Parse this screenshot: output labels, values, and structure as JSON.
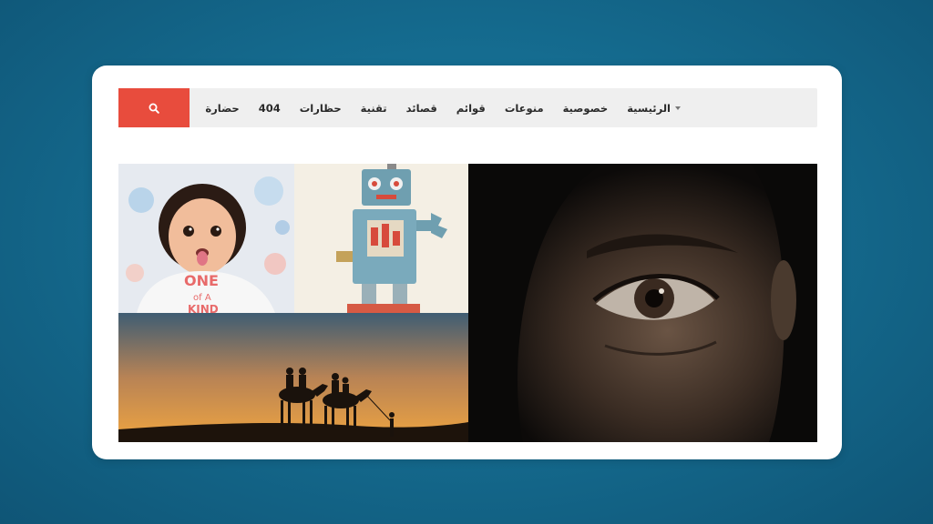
{
  "colors": {
    "background": "#156c90",
    "card": "#ffffff",
    "navbar": "#efefef",
    "search_button": "#e84c3d",
    "menu_text": "#2a2a2a"
  },
  "search": {
    "icon": "search-icon"
  },
  "menu": {
    "items": [
      {
        "label": "الرئيسية",
        "has_dropdown": true
      },
      {
        "label": "خصوصية"
      },
      {
        "label": "منوعات"
      },
      {
        "label": "قوائم"
      },
      {
        "label": "قصائد"
      },
      {
        "label": "تقنية"
      },
      {
        "label": "حظارات"
      },
      {
        "label": "404"
      },
      {
        "label": "حضارة"
      }
    ]
  },
  "gallery": {
    "tiles": [
      {
        "subject": "baby"
      },
      {
        "subject": "toy-robot"
      },
      {
        "subject": "camels-desert-sunset"
      },
      {
        "subject": "man-eye-closeup"
      }
    ],
    "baby_shirt_text": [
      "ONE",
      "of A",
      "KIND"
    ]
  }
}
